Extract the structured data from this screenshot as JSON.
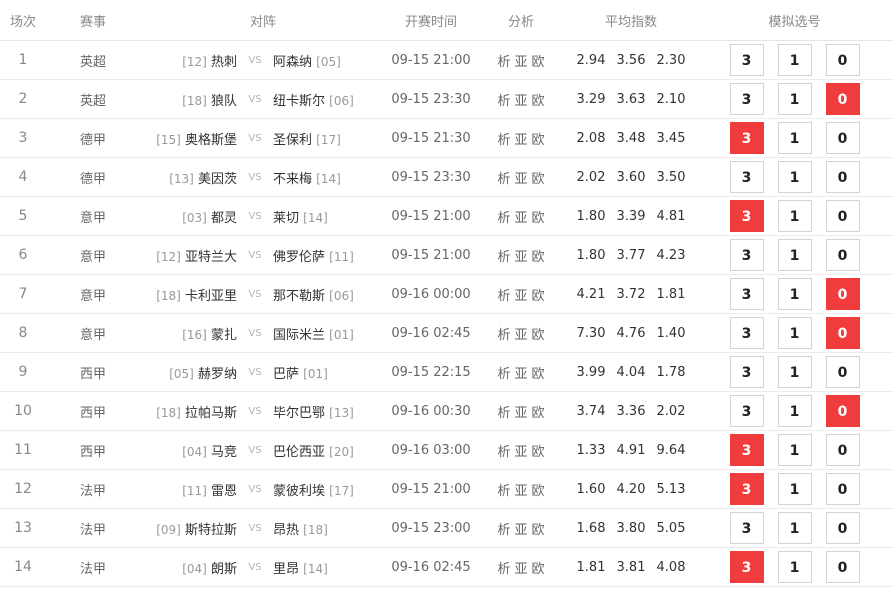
{
  "headers": {
    "num": "场次",
    "league": "赛事",
    "match": "对阵",
    "time": "开赛时间",
    "analysis": "分析",
    "odds": "平均指数",
    "pick": "模拟选号"
  },
  "vs_label": "VS",
  "analysis_labels": [
    "析",
    "亚",
    "欧"
  ],
  "pick_labels": [
    "3",
    "1",
    "0"
  ],
  "colors": {
    "selected": "#f03c3c",
    "border": "#d4d4d4"
  },
  "rows": [
    {
      "num": "1",
      "league": "英超",
      "home_rank": "[12]",
      "home": "热刺",
      "away": "阿森纳",
      "away_rank": "[05]",
      "time": "09-15 21:00",
      "odds": [
        "2.94",
        "3.56",
        "2.30"
      ],
      "selected": ""
    },
    {
      "num": "2",
      "league": "英超",
      "home_rank": "[18]",
      "home": "狼队",
      "away": "纽卡斯尔",
      "away_rank": "[06]",
      "time": "09-15 23:30",
      "odds": [
        "3.29",
        "3.63",
        "2.10"
      ],
      "selected": "0"
    },
    {
      "num": "3",
      "league": "德甲",
      "home_rank": "[15]",
      "home": "奥格斯堡",
      "away": "圣保利",
      "away_rank": "[17]",
      "time": "09-15 21:30",
      "odds": [
        "2.08",
        "3.48",
        "3.45"
      ],
      "selected": "3"
    },
    {
      "num": "4",
      "league": "德甲",
      "home_rank": "[13]",
      "home": "美因茨",
      "away": "不来梅",
      "away_rank": "[14]",
      "time": "09-15 23:30",
      "odds": [
        "2.02",
        "3.60",
        "3.50"
      ],
      "selected": ""
    },
    {
      "num": "5",
      "league": "意甲",
      "home_rank": "[03]",
      "home": "都灵",
      "away": "莱切",
      "away_rank": "[14]",
      "time": "09-15 21:00",
      "odds": [
        "1.80",
        "3.39",
        "4.81"
      ],
      "selected": "3"
    },
    {
      "num": "6",
      "league": "意甲",
      "home_rank": "[12]",
      "home": "亚特兰大",
      "away": "佛罗伦萨",
      "away_rank": "[11]",
      "time": "09-15 21:00",
      "odds": [
        "1.80",
        "3.77",
        "4.23"
      ],
      "selected": ""
    },
    {
      "num": "7",
      "league": "意甲",
      "home_rank": "[18]",
      "home": "卡利亚里",
      "away": "那不勒斯",
      "away_rank": "[06]",
      "time": "09-16 00:00",
      "odds": [
        "4.21",
        "3.72",
        "1.81"
      ],
      "selected": "0"
    },
    {
      "num": "8",
      "league": "意甲",
      "home_rank": "[16]",
      "home": "蒙扎",
      "away": "国际米兰",
      "away_rank": "[01]",
      "time": "09-16 02:45",
      "odds": [
        "7.30",
        "4.76",
        "1.40"
      ],
      "selected": "0"
    },
    {
      "num": "9",
      "league": "西甲",
      "home_rank": "[05]",
      "home": "赫罗纳",
      "away": "巴萨",
      "away_rank": "[01]",
      "time": "09-15 22:15",
      "odds": [
        "3.99",
        "4.04",
        "1.78"
      ],
      "selected": ""
    },
    {
      "num": "10",
      "league": "西甲",
      "home_rank": "[18]",
      "home": "拉帕马斯",
      "away": "毕尔巴鄂",
      "away_rank": "[13]",
      "time": "09-16 00:30",
      "odds": [
        "3.74",
        "3.36",
        "2.02"
      ],
      "selected": "0"
    },
    {
      "num": "11",
      "league": "西甲",
      "home_rank": "[04]",
      "home": "马竞",
      "away": "巴伦西亚",
      "away_rank": "[20]",
      "time": "09-16 03:00",
      "odds": [
        "1.33",
        "4.91",
        "9.64"
      ],
      "selected": "3"
    },
    {
      "num": "12",
      "league": "法甲",
      "home_rank": "[11]",
      "home": "雷恩",
      "away": "蒙彼利埃",
      "away_rank": "[17]",
      "time": "09-15 21:00",
      "odds": [
        "1.60",
        "4.20",
        "5.13"
      ],
      "selected": "3"
    },
    {
      "num": "13",
      "league": "法甲",
      "home_rank": "[09]",
      "home": "斯特拉斯",
      "away": "昂热",
      "away_rank": "[18]",
      "time": "09-15 23:00",
      "odds": [
        "1.68",
        "3.80",
        "5.05"
      ],
      "selected": ""
    },
    {
      "num": "14",
      "league": "法甲",
      "home_rank": "[04]",
      "home": "朗斯",
      "away": "里昂",
      "away_rank": "[14]",
      "time": "09-16 02:45",
      "odds": [
        "1.81",
        "3.81",
        "4.08"
      ],
      "selected": "3"
    }
  ]
}
